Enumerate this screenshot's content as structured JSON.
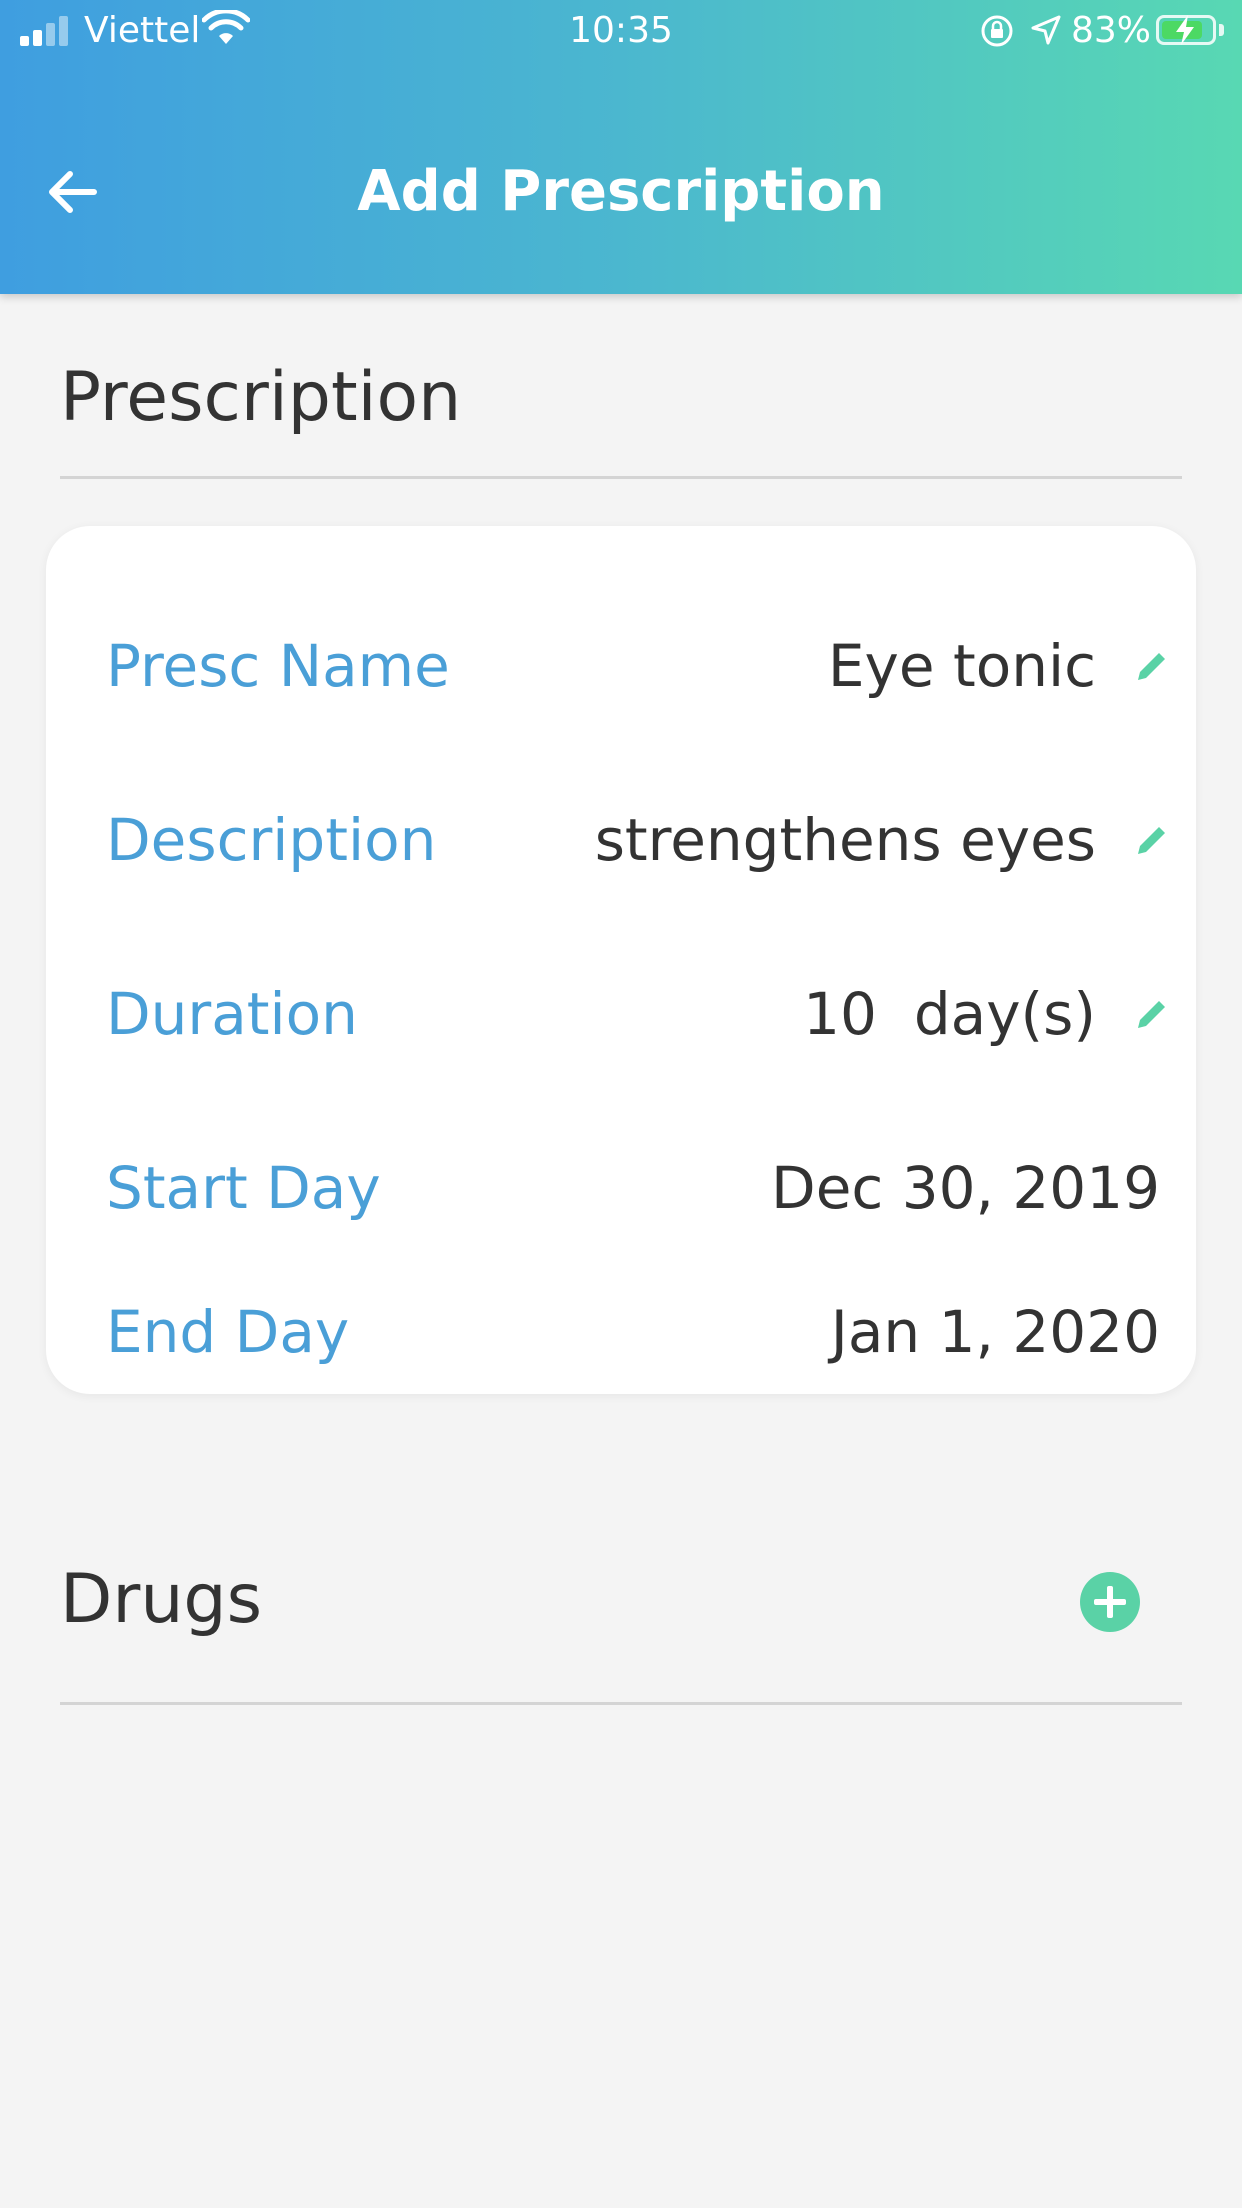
{
  "status_bar": {
    "carrier": "Viettel",
    "time": "10:35",
    "battery": "83%",
    "battery_level": 0.83,
    "icons": [
      "signal-icon",
      "wifi-icon",
      "orientation-lock-icon",
      "location-arrow-icon",
      "battery-charging-icon"
    ]
  },
  "header": {
    "title": "Add Prescription",
    "back_icon": "arrow-left-icon",
    "gradient_colors": [
      "#3f9ee0",
      "#58d8b3"
    ]
  },
  "prescription": {
    "section_title": "Prescription",
    "fields": [
      {
        "label": "Presc Name",
        "value": "Eye tonic",
        "editable": true
      },
      {
        "label": "Description",
        "value": "strengthens eyes",
        "editable": true
      },
      {
        "label": "Duration",
        "value": "10  day(s)",
        "editable": true
      },
      {
        "label": "Start Day",
        "value": "Dec 30, 2019",
        "editable": false
      },
      {
        "label": "End Day",
        "value": "Jan 1, 2020",
        "editable": false
      }
    ]
  },
  "drugs": {
    "section_title": "Drugs",
    "add_icon": "plus-circle-icon"
  },
  "colors": {
    "label": "#4a9fd7",
    "accent": "#5ad2a6",
    "text": "#333333",
    "background": "#f4f4f4"
  }
}
